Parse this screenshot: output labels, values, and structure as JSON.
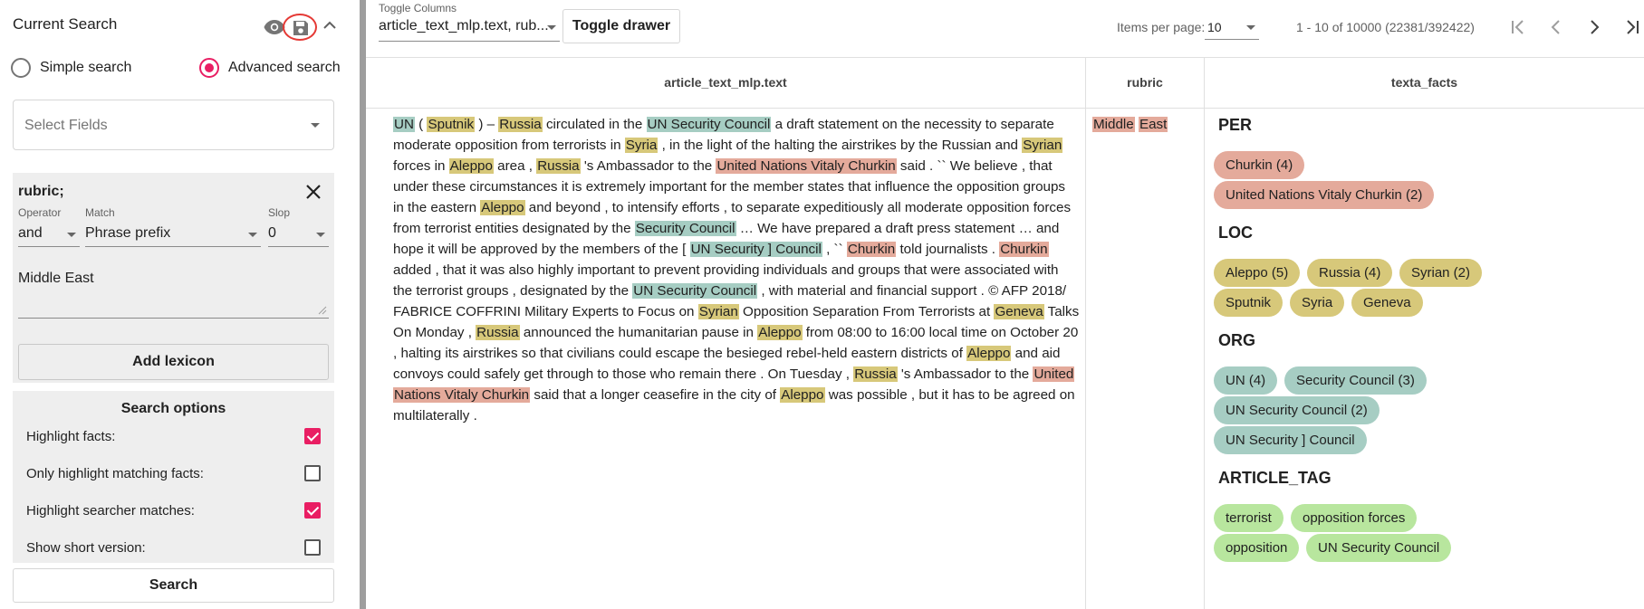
{
  "sidebar": {
    "header": "Current Search",
    "icons": {
      "visibility": "eye-icon",
      "save": "save-icon",
      "collapse": "chevron-up-icon"
    },
    "modes": {
      "simple": "Simple search",
      "advanced": "Advanced search",
      "selected": "advanced"
    },
    "select_fields_placeholder": "Select Fields",
    "rubric_block": {
      "title": "rubric;",
      "operator_label": "Operator",
      "operator_value": "and",
      "match_label": "Match",
      "match_value": "Phrase prefix",
      "slop_label": "Slop",
      "slop_value": "0",
      "query": "Middle East",
      "add_lexicon": "Add lexicon"
    },
    "search_options": {
      "title": "Search options",
      "items": [
        {
          "label": "Highlight facts:",
          "checked": true
        },
        {
          "label": "Only highlight matching facts:",
          "checked": false
        },
        {
          "label": "Highlight searcher matches:",
          "checked": true
        },
        {
          "label": "Show short version:",
          "checked": false
        }
      ]
    },
    "search_button": "Search"
  },
  "toolbar": {
    "toggle_columns_label": "Toggle Columns",
    "toggle_columns_value": "article_text_mlp.text, rub...",
    "toggle_drawer": "Toggle drawer",
    "items_per_page_label": "Items per page:",
    "items_per_page_value": "10",
    "range": "1 - 10 of 10000 (22381/392422)"
  },
  "columns": [
    "article_text_mlp.text",
    "rubric",
    "texta_facts"
  ],
  "colors": {
    "org": "#a6cdc3",
    "loc": "#d7c87a",
    "per": "#e4aa9b",
    "tag": "#b8e69e",
    "accent": "#e91e63"
  },
  "article": {
    "lines": [
      [
        [
          "UN",
          "org"
        ],
        [
          " ( ",
          ""
        ],
        [
          "Sputnik",
          "loc"
        ],
        [
          " ) – ",
          ""
        ],
        [
          "Russia",
          "loc"
        ],
        [
          " circulated in the ",
          ""
        ],
        [
          "UN Security Council",
          "org"
        ],
        [
          " a draft statement on the necessity to separate",
          ""
        ]
      ],
      [
        [
          "moderate opposition from terrorists in ",
          ""
        ],
        [
          "Syria",
          "loc"
        ],
        [
          " , in the light of the halting the airstrikes by the Russian and ",
          ""
        ],
        [
          "Syrian",
          "loc"
        ]
      ],
      [
        [
          "forces in ",
          ""
        ],
        [
          "Aleppo",
          "loc"
        ],
        [
          " area , ",
          ""
        ],
        [
          "Russia",
          "loc"
        ],
        [
          " 's Ambassador to the ",
          ""
        ],
        [
          "United Nations Vitaly Churkin",
          "per"
        ],
        [
          " said . `` We believe , that",
          ""
        ]
      ],
      [
        [
          "under these circumstances it is extremely important for the member states that influence the opposition groups",
          ""
        ]
      ],
      [
        [
          "in the eastern ",
          ""
        ],
        [
          "Aleppo",
          "loc"
        ],
        [
          " and beyond , to intensify efforts , to separate expeditiously all moderate opposition forces",
          ""
        ]
      ],
      [
        [
          "from terrorist entities designated by the ",
          ""
        ],
        [
          "Security Council",
          "org"
        ],
        [
          " … We have prepared a draft press statement … and",
          ""
        ]
      ],
      [
        [
          "hope it will be approved by the members of the [ ",
          ""
        ],
        [
          "UN Security ] Council",
          "org"
        ],
        [
          " , `` ",
          ""
        ],
        [
          "Churkin",
          "per"
        ],
        [
          " told journalists . ",
          ""
        ],
        [
          "Churkin",
          "per"
        ]
      ],
      [
        [
          "added , that it was also highly important to prevent providing individuals and groups that were associated with",
          ""
        ]
      ],
      [
        [
          "the terrorist groups , designated by the ",
          ""
        ],
        [
          "UN Security Council",
          "org"
        ],
        [
          " , with material and financial support . © AFP 2018/",
          ""
        ]
      ],
      [
        [
          "FABRICE COFFRINI Military Experts to Focus on ",
          ""
        ],
        [
          "Syrian",
          "loc"
        ],
        [
          " Opposition Separation From Terrorists at ",
          ""
        ],
        [
          "Geneva",
          "loc"
        ],
        [
          " Talks",
          ""
        ]
      ],
      [
        [
          "On Monday , ",
          ""
        ],
        [
          "Russia",
          "loc"
        ],
        [
          " announced the humanitarian pause in ",
          ""
        ],
        [
          "Aleppo",
          "loc"
        ],
        [
          " from 08:00 to 16:00 local time on October 20",
          ""
        ]
      ],
      [
        [
          ", halting its airstrikes so that civilians could escape the besieged rebel-held eastern districts of ",
          ""
        ],
        [
          "Aleppo",
          "loc"
        ],
        [
          " and aid",
          ""
        ]
      ],
      [
        [
          "convoys could safely get through to those who remain there . On Tuesday , ",
          ""
        ],
        [
          "Russia",
          "loc"
        ],
        [
          " 's Ambassador to the ",
          ""
        ],
        [
          "United",
          "per"
        ]
      ],
      [
        [
          "Nations Vitaly Churkin",
          "per"
        ],
        [
          " said that a longer ceasefire in the city of ",
          ""
        ],
        [
          "Aleppo",
          "loc"
        ],
        [
          " was possible , but it has to be agreed on",
          ""
        ]
      ],
      [
        [
          "multilaterally .",
          ""
        ]
      ]
    ]
  },
  "rubric_value": [
    [
      "Middle",
      "per"
    ],
    [
      " ",
      ""
    ],
    [
      "East",
      "per"
    ]
  ],
  "facts": [
    {
      "title": "PER",
      "type": "per",
      "rows": [
        [
          "Churkin (4)"
        ],
        [
          "United Nations Vitaly Churkin (2)"
        ]
      ]
    },
    {
      "title": "LOC",
      "type": "loc",
      "rows": [
        [
          "Aleppo (5)",
          "Russia (4)",
          "Syrian (2)"
        ],
        [
          "Sputnik",
          "Syria",
          "Geneva"
        ]
      ]
    },
    {
      "title": "ORG",
      "type": "org",
      "rows": [
        [
          "UN (4)",
          "Security Council (3)"
        ],
        [
          "UN Security Council (2)"
        ],
        [
          "UN Security ] Council"
        ]
      ]
    },
    {
      "title": "ARTICLE_TAG",
      "type": "tag",
      "rows": [
        [
          "terrorist",
          "opposition forces"
        ],
        [
          "opposition",
          "UN Security Council"
        ]
      ]
    }
  ]
}
